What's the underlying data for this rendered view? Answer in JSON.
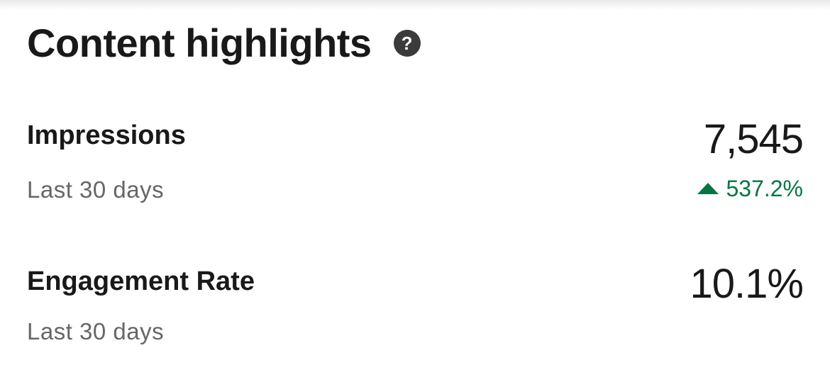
{
  "header": {
    "title": "Content highlights",
    "help_icon": "question-circle-icon",
    "help_glyph": "?"
  },
  "metrics": [
    {
      "label": "Impressions",
      "period": "Last 30 days",
      "value": "7,545",
      "change": "537.2%",
      "change_direction": "up",
      "change_color": "#057642"
    },
    {
      "label": "Engagement Rate",
      "period": "Last 30 days",
      "value": "10.1%"
    }
  ]
}
